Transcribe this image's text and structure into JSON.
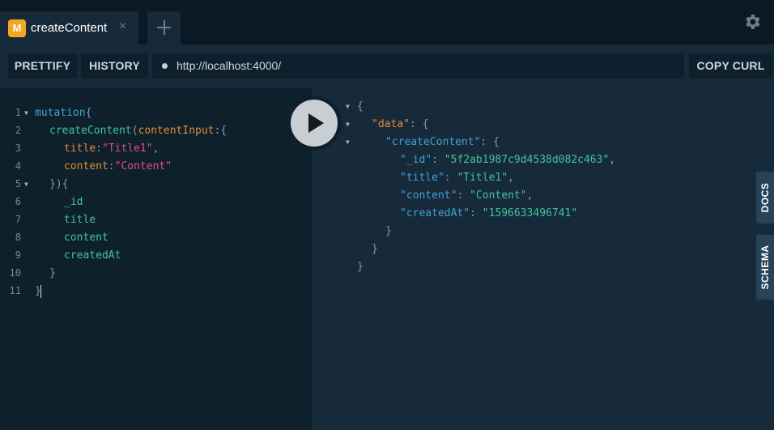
{
  "tab": {
    "logo": "M",
    "title": "createContent",
    "close": "×"
  },
  "add_tab": {
    "icon": "plus-icon"
  },
  "settings": {
    "icon": "gear-icon"
  },
  "toolbar": {
    "prettify_label": "PRETTIFY",
    "history_label": "HISTORY",
    "url": "http://localhost:4000/",
    "copy_curl_label": "COPY CURL"
  },
  "editor": {
    "lines": [
      {
        "num": "1",
        "fold": true
      },
      {
        "num": "2",
        "fold": false
      },
      {
        "num": "3",
        "fold": false
      },
      {
        "num": "4",
        "fold": false
      },
      {
        "num": "5",
        "fold": true
      },
      {
        "num": "6",
        "fold": false
      },
      {
        "num": "7",
        "fold": false
      },
      {
        "num": "8",
        "fold": false
      },
      {
        "num": "9",
        "fold": false
      },
      {
        "num": "10",
        "fold": false
      },
      {
        "num": "11",
        "fold": false
      }
    ],
    "mutation_kw": "mutation",
    "brace_open": "{",
    "fn_name": "createContent",
    "paren_open": "(",
    "arg_name": "contentInput",
    "colon_brace": ":{",
    "title_key": "title",
    "title_val": "\"Title1\"",
    "content_key": "content",
    "content_val": "\"Content\"",
    "comma": ",",
    "colon": ":",
    "close_paren_brace": "}){",
    "f_id": "_id",
    "f_title": "title",
    "f_content": "content",
    "f_createdAt": "createdAt",
    "brace_close": "}"
  },
  "result": {
    "brace_open": "{",
    "brace_close": "}",
    "data_key": "\"data\"",
    "create_key": "\"createContent\"",
    "id_key": "\"_id\"",
    "id_val": "\"5f2ab1987c9d4538d082c463\"",
    "title_key": "\"title\"",
    "title_val": "\"Title1\"",
    "content_key": "\"content\"",
    "content_val": "\"Content\"",
    "created_key": "\"createdAt\"",
    "created_val": "\"1596633496741\"",
    "colon_brace": ": {",
    "colon": ": ",
    "comma": ","
  },
  "run": {
    "icon": "play-icon"
  },
  "side_tabs": {
    "docs": "DOCS",
    "schema": "SCHEMA"
  }
}
